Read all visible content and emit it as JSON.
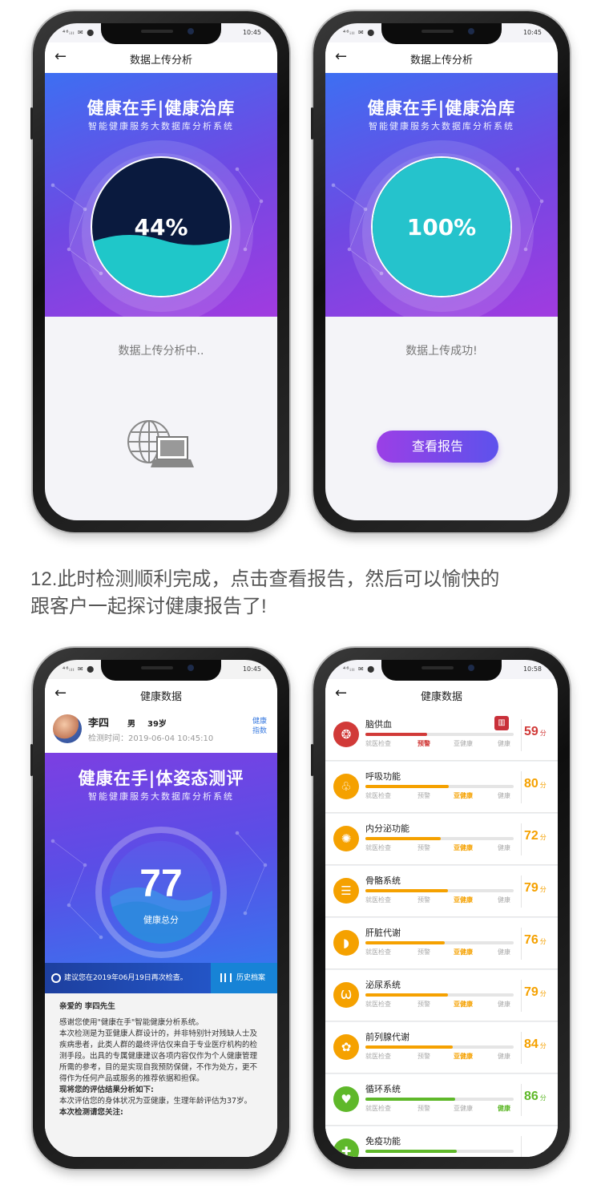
{
  "colors": {
    "accent": "#7b45e4",
    "red": "#d13a38",
    "orange": "#f5a100",
    "green": "#5fb82a"
  },
  "status_bar": {
    "left": "⁴⁶ᵢₗₗ ✉ ⬤",
    "time1": "10:45",
    "time4": "10:58"
  },
  "phone1": {
    "nav_title": "数据上传分析",
    "hero_title": "健康在手|健康治库",
    "hero_subtitle": "智能健康服务大数据库分析系统",
    "progress_text": "44%",
    "progress": 0.44,
    "status": "数据上传分析中.."
  },
  "phone2": {
    "nav_title": "数据上传分析",
    "hero_title": "健康在手|健康治库",
    "hero_subtitle": "智能健康服务大数据库分析系统",
    "progress_text": "100%",
    "progress": 1.0,
    "status": "数据上传成功!",
    "button": "查看报告"
  },
  "caption": {
    "line1": "12.此时检测顺利完成，点击查看报告，然后可以愉快的",
    "line2": "跟客户一起探讨健康报告了!"
  },
  "phone3": {
    "nav_title": "健康数据",
    "user": {
      "name": "李四",
      "sex": "男",
      "age": "39岁",
      "time": "检测时间：2019-06-04 10:45:10",
      "index_link": "健康指数"
    },
    "hero_title": "健康在手|体姿态测评",
    "hero_subtitle": "智能健康服务大数据库分析系统",
    "score": "77",
    "score_label": "健康总分",
    "recommend": "建议您在2019年06月19日再次检查。",
    "history": "历史档案",
    "letter": {
      "greeting": "亲爱的 李四先生",
      "p1": "感谢您使用\"健康在手\"智能健康分析系统。",
      "p2": "本次检测是为亚健康人群设计的，并非特别针对残缺人士及疾病患者，此类人群的最终评估仅来自于专业医疗机构的检测手段。出具的专属健康建议各项内容仅作为个人健康管理所需的参考，目的是实现自我预防保健，不作为处方，更不得作为任何产品或服务的推荐依据和担保。",
      "h2": "现将您的评估结果分析如下:",
      "p3": "本次评估您的身体状况为亚健康，生理年龄评估为37岁。",
      "h3": "本次检测请您关注:"
    }
  },
  "phone4": {
    "nav_title": "健康数据",
    "levels": [
      "就医检查",
      "预警",
      "亚健康",
      "健康"
    ],
    "score_unit": "分",
    "items": [
      {
        "name": "脑供血",
        "score": "59",
        "value": 59,
        "level_index": 1,
        "color": "#d13a38",
        "icon": "brain-icon",
        "glyph": "❂"
      },
      {
        "name": "呼吸功能",
        "score": "80",
        "value": 80,
        "level_index": 2,
        "color": "#f5a100",
        "icon": "lungs-icon",
        "glyph": "♧"
      },
      {
        "name": "内分泌功能",
        "score": "72",
        "value": 72,
        "level_index": 2,
        "color": "#f5a100",
        "icon": "gland-icon",
        "glyph": "✺"
      },
      {
        "name": "骨骼系统",
        "score": "79",
        "value": 79,
        "level_index": 2,
        "color": "#f5a100",
        "icon": "ribcage-icon",
        "glyph": "☰"
      },
      {
        "name": "肝脏代谢",
        "score": "76",
        "value": 76,
        "level_index": 2,
        "color": "#f5a100",
        "icon": "liver-icon",
        "glyph": "◗"
      },
      {
        "name": "泌尿系统",
        "score": "79",
        "value": 79,
        "level_index": 2,
        "color": "#f5a100",
        "icon": "kidney-icon",
        "glyph": "Ѡ"
      },
      {
        "name": "前列腺代谢",
        "score": "84",
        "value": 84,
        "level_index": 2,
        "color": "#f5a100",
        "icon": "prostate-icon",
        "glyph": "✿"
      },
      {
        "name": "循环系统",
        "score": "86",
        "value": 86,
        "level_index": 3,
        "color": "#5fb82a",
        "icon": "heart-icon",
        "glyph": "♥"
      },
      {
        "name": "免疫功能",
        "score": "",
        "value": 88,
        "level_index": 3,
        "color": "#5fb82a",
        "icon": "immune-icon",
        "glyph": "✚"
      }
    ]
  }
}
